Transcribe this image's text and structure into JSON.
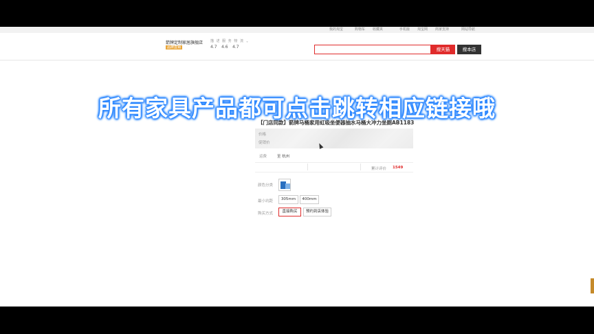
{
  "topnav": [
    "我的淘宝",
    "购物车",
    "收藏夹",
    "手机版",
    "淘宝网",
    "商家支持",
    "网站导航"
  ],
  "header": {
    "shop_name": "箭牌定制家居旗舰店",
    "badge": "品牌直销",
    "rating_labels": "描 述 服 务 物 流",
    "scores": [
      "4.7",
      "4.6",
      "4.7"
    ],
    "search_placeholder": "",
    "btn_tmall": "搜天猫",
    "btn_shop": "搜本店"
  },
  "overlay_text": "所有家具产品都可点击跳转相应链接哦",
  "product": {
    "title": "【门店同款】箭牌马桶家用虹吸坐便器抽水马桶大冲力坐厕AB1183",
    "price_label": "价格",
    "promo_label": "促销价",
    "ship_label": "运费",
    "ship_value": "至 杭州",
    "sales_label": "累计评价",
    "sales_value": "1549",
    "color_label": "颜色分类",
    "pit_label": "最小坑距",
    "pit_options": [
      "305mm",
      "400mm"
    ],
    "buy_label": "购买方式",
    "buy_options": [
      "直接购买",
      "预约到店体验"
    ],
    "colors": {
      "accent": "#e02b2b",
      "overlay_glow": "#2f89ff"
    }
  }
}
